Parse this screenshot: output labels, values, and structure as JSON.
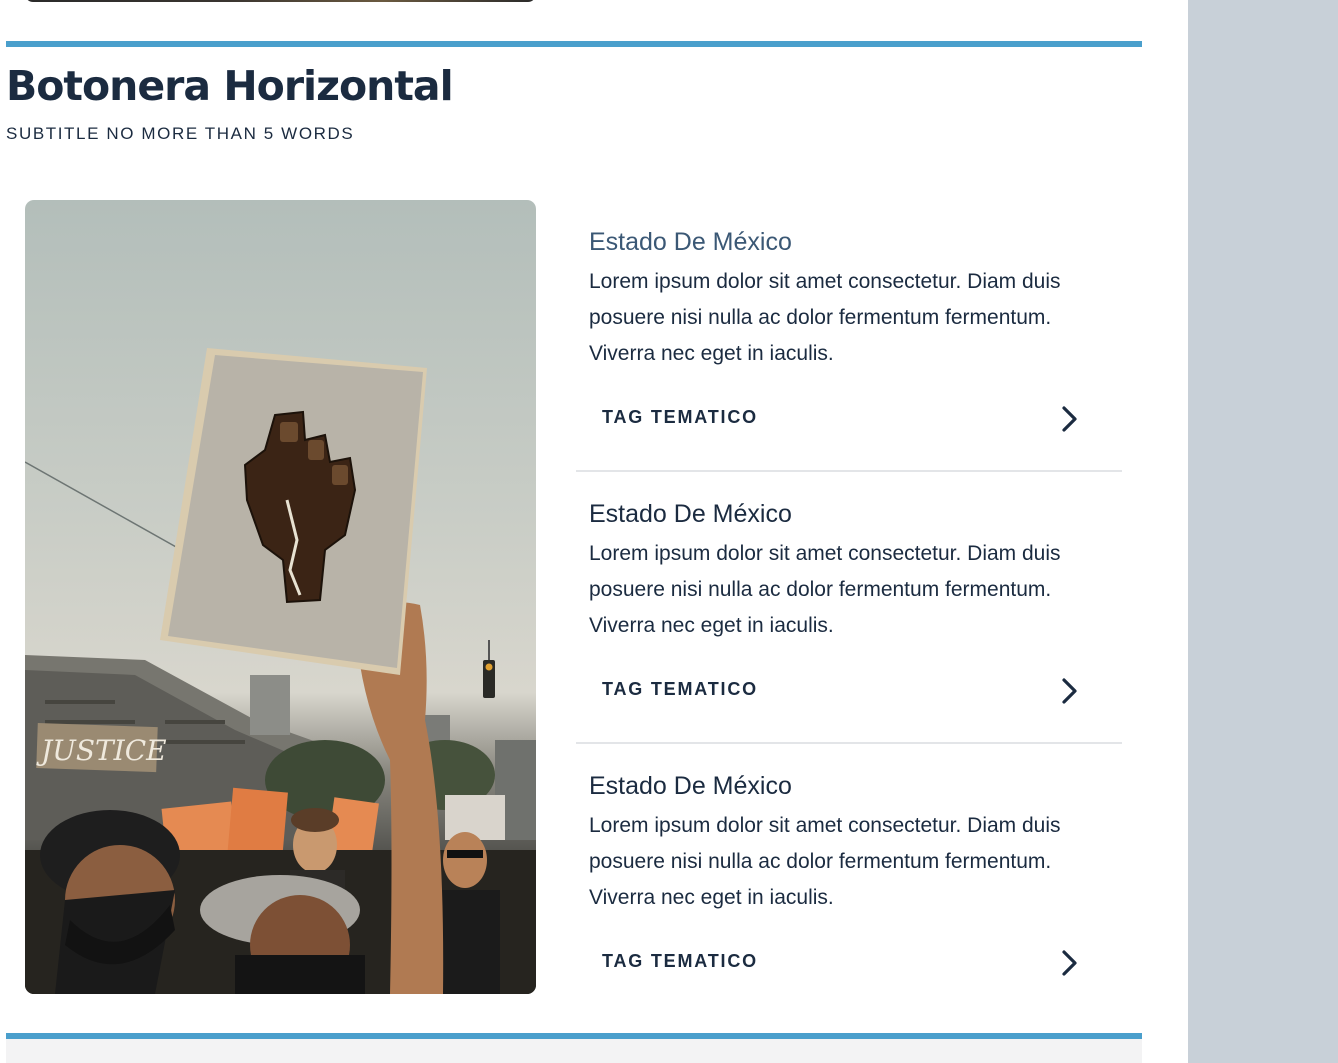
{
  "section": {
    "title": "Botonera Horizontal",
    "subtitle": "SUBTITLE NO MORE THAN 5 WORDS"
  },
  "hero": {
    "sign_text": "JUSTICE"
  },
  "items": [
    {
      "title": "Estado De México",
      "body": "Lorem ipsum dolor sit amet consectetur. Diam duis posuere nisi nulla ac dolor fermentum fermentum. Viverra nec eget in iaculis.",
      "tag": "TAG TEMATICO",
      "chevron_icon": "chevron-right-icon"
    },
    {
      "title": "Estado De México",
      "body": "Lorem ipsum dolor sit amet consectetur. Diam duis posuere nisi nulla ac dolor fermentum fermentum. Viverra nec eget in iaculis.",
      "tag": "TAG TEMATICO",
      "chevron_icon": "chevron-right-icon"
    },
    {
      "title": "Estado De México",
      "body": "Lorem ipsum dolor sit amet consectetur. Diam duis posuere nisi nulla ac dolor fermentum fermentum. Viverra nec eget in iaculis.",
      "tag": "TAG TEMATICO",
      "chevron_icon": "chevron-right-icon"
    }
  ],
  "colors": {
    "accent_rule": "#4a9fcc",
    "heading": "#1b2b40",
    "highlighted_title": "#3b5875",
    "side_panel": "#c8d0d8",
    "divider": "#e3e5e8"
  }
}
